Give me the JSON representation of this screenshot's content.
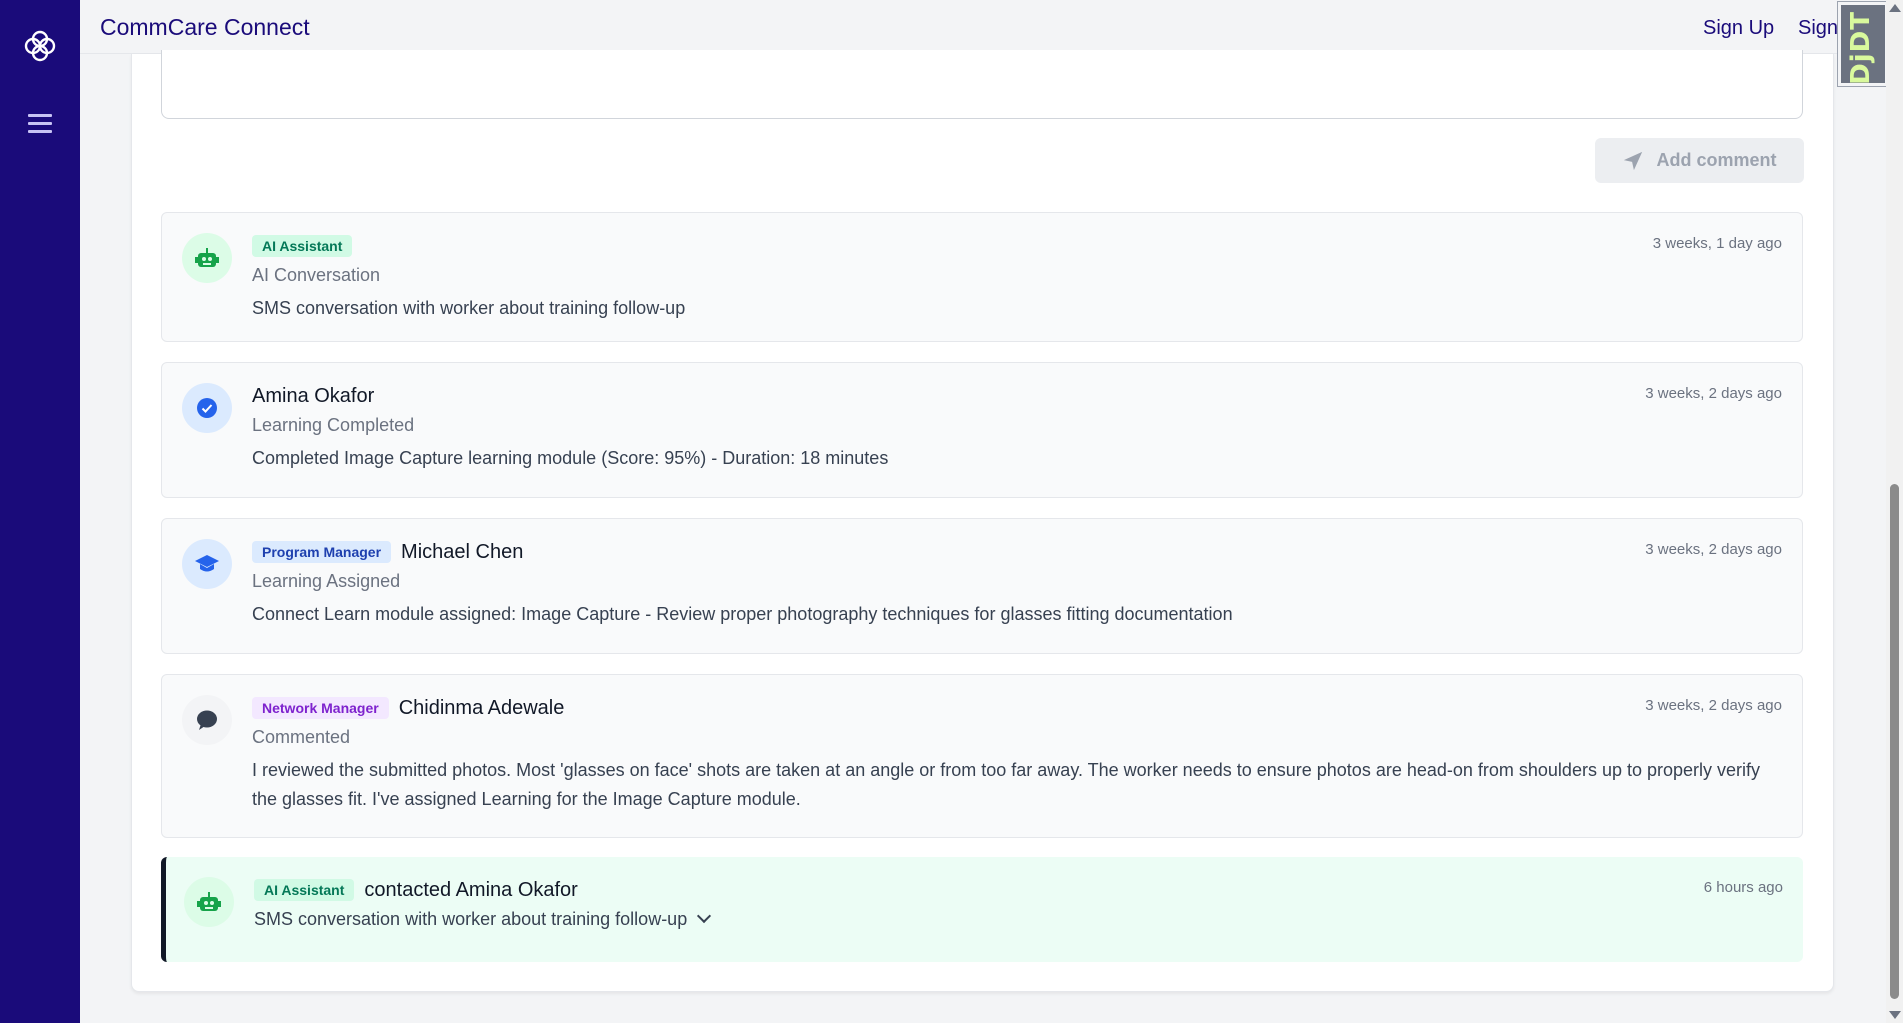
{
  "app": {
    "title": "CommCare Connect"
  },
  "topnav": {
    "signup": "Sign Up",
    "signin": "Sign In"
  },
  "debug_toolbar": {
    "label": "DjDT"
  },
  "comment_box": {
    "button_label": "Add comment"
  },
  "activities": [
    {
      "badge": "AI Assistant",
      "name": "",
      "action": "AI Conversation",
      "description": "SMS conversation with worker about training follow-up",
      "time": "3 weeks, 1 day ago",
      "icon": "robot-icon"
    },
    {
      "badge": "",
      "name": "Amina Okafor",
      "action": "Learning Completed",
      "description": "Completed Image Capture learning module (Score: 95%) - Duration: 18 minutes",
      "time": "3 weeks, 2 days ago",
      "icon": "check-circle-icon"
    },
    {
      "badge": "Program Manager",
      "name": "Michael Chen",
      "action": "Learning Assigned",
      "description": "Connect Learn module assigned: Image Capture - Review proper photography techniques for glasses fitting documentation",
      "time": "3 weeks, 2 days ago",
      "icon": "graduation-cap-icon"
    },
    {
      "badge": "Network Manager",
      "name": "Chidinma Adewale",
      "action": "Commented",
      "description": "I reviewed the submitted photos. Most 'glasses on face' shots are taken at an angle or from too far away. The worker needs to ensure photos are head-on from shoulders up to properly verify the glasses fit. I've assigned Learning for the Image Capture module.",
      "time": "3 weeks, 2 days ago",
      "icon": "comment-icon"
    }
  ],
  "latest": {
    "badge": "AI Assistant",
    "title": "contacted Amina Okafor",
    "summary": "SMS conversation with worker about training follow-up",
    "time": "6 hours ago",
    "icon": "robot-icon"
  },
  "colors": {
    "sidebar": "#1a0b7a",
    "brand": "#1a0b7a",
    "ai_green": "#16a34a",
    "highlight_bg": "#ecfdf5"
  }
}
